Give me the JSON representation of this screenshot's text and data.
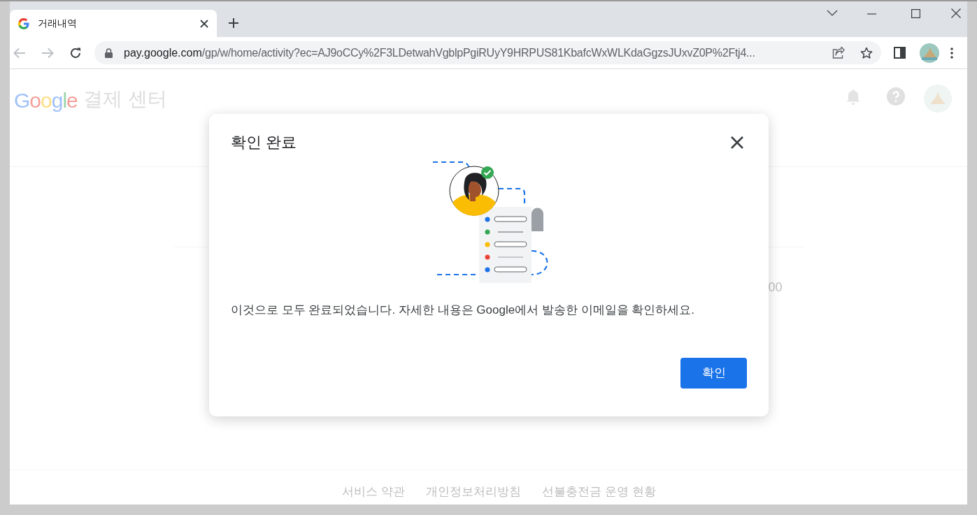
{
  "browser": {
    "tab": {
      "title": "거래내역"
    },
    "url": {
      "host": "pay.google.com",
      "path": "/gp/w/home/activity?ec=AJ9oCCy%2F3LDetwahVgblpPgiRUyY9HRPUS81KbafcWxWLKdaGgzsJUxvZ0P%2Ftj4..."
    }
  },
  "page": {
    "logo": "Google",
    "title": "결제 센터",
    "amount_fragment": "00",
    "footer_links": [
      "서비스 약관",
      "개인정보처리방침",
      "선불충전금 운영 현황"
    ]
  },
  "dialog": {
    "title": "확인 완료",
    "message": "이것으로 모두 완료되었습니다. 자세한 내용은 Google에서 발송한 이메일을 확인하세요.",
    "button": "확인"
  }
}
